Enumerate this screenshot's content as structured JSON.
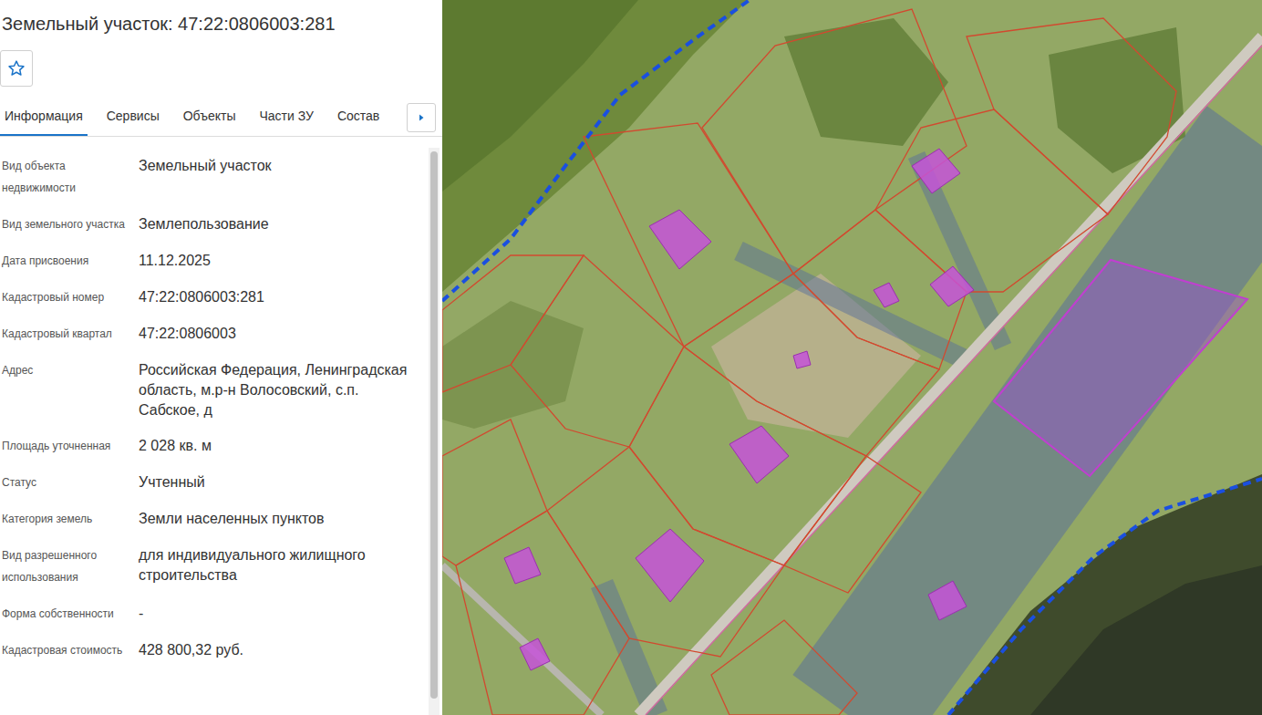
{
  "panel": {
    "title": "Земельный участок: 47:22:0806003:281"
  },
  "tabs": [
    {
      "label": "Информация",
      "selected": true
    },
    {
      "label": "Сервисы",
      "selected": false
    },
    {
      "label": "Объекты",
      "selected": false
    },
    {
      "label": "Части ЗУ",
      "selected": false
    },
    {
      "label": "Состав",
      "selected": false
    }
  ],
  "fields": [
    {
      "label": "Вид объекта недвижимости",
      "value": "Земельный участок"
    },
    {
      "label": "Вид земельного участка",
      "value": "Землепользование"
    },
    {
      "label": "Дата присвоения",
      "value": "11.12.2025"
    },
    {
      "label": "Кадастровый номер",
      "value": "47:22:0806003:281"
    },
    {
      "label": "Кадастровый квартал",
      "value": "47:22:0806003"
    },
    {
      "label": "Адрес",
      "value": "Российская Федерация, Ленинградская область, м.р-н Волосовский, с.п. Сабское, д"
    },
    {
      "label": "Площадь уточненная",
      "value": "2 028 кв. м"
    },
    {
      "label": "Статус",
      "value": "Учтенный"
    },
    {
      "label": "Категория земель",
      "value": "Земли населенных пунктов"
    },
    {
      "label": "Вид разрешенного использования",
      "value": "для индивидуального жилищного строительства"
    },
    {
      "label": "Форма собственности",
      "value": "-"
    },
    {
      "label": "Кадастровая стоимость",
      "value": "428 800,32 руб."
    }
  ]
}
